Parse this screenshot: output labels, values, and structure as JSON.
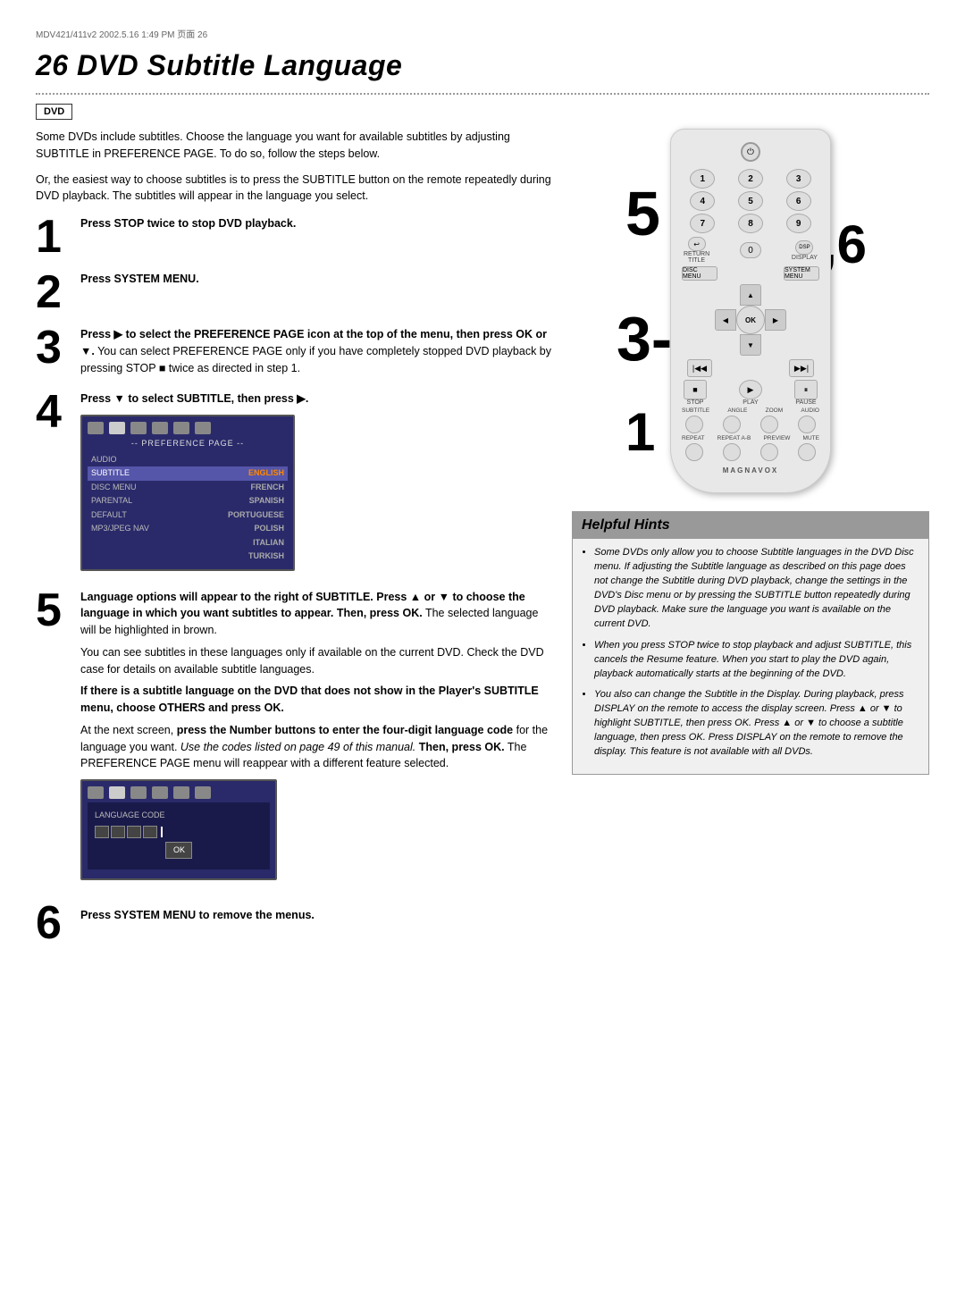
{
  "header": {
    "file_info": "MDV421/411v2  2002.5.16  1:49 PM  页面 26"
  },
  "page": {
    "title": "26  DVD Subtitle Language",
    "dvd_badge": "DVD"
  },
  "intro": {
    "text1": "Some DVDs include subtitles. Choose the language you want for available subtitles by adjusting SUBTITLE in PREFERENCE PAGE. To do so, follow the steps below.",
    "text2": "Or, the easiest way to choose subtitles is to press the SUBTITLE button on the remote repeatedly during DVD playback. The subtitles will appear in the language you select."
  },
  "steps": {
    "step1": {
      "number": "1",
      "text": "Press STOP twice to stop DVD playback."
    },
    "step2": {
      "number": "2",
      "text": "Press SYSTEM MENU."
    },
    "step3": {
      "number": "3",
      "text_bold": "Press ▶ to select the PREFERENCE PAGE icon at the top of the menu, then press OK or ▼.",
      "text_normal": "You can select PREFERENCE PAGE only if you have completely stopped DVD playback by pressing STOP ■ twice as directed in step 1."
    },
    "step4": {
      "number": "4",
      "text": "Press ▼ to select SUBTITLE, then press ▶.",
      "screen": {
        "title": "-- PREFERENCE PAGE --",
        "rows": [
          {
            "label": "AUDIO",
            "value": ""
          },
          {
            "label": "SUBTITLE",
            "value": "ENGLISH",
            "highlighted": true
          },
          {
            "label": "DISC MENU",
            "value": "FRENCH"
          },
          {
            "label": "PARENTAL",
            "value": "SPANISH"
          },
          {
            "label": "DEFAULT",
            "value": "PORTUGUESE"
          },
          {
            "label": "MP3/JPEG NAV",
            "value": "POLISH"
          },
          {
            "label": "",
            "value": "ITALIAN"
          },
          {
            "label": "",
            "value": "TURKISH"
          }
        ]
      }
    },
    "step5": {
      "number": "5",
      "text1_bold": "Language options will appear to the right of SUBTITLE. Press ▲ or ▼ to choose the language in which you want subtitles to appear. Then, press OK.",
      "text1_normal": "The selected language will be highlighted in brown.",
      "text2": "You can see subtitles in these languages only if available on the current DVD. Check the DVD case for details on available subtitle languages.",
      "text3_bold": "If there is a subtitle language on the DVD that does not show in the Player's SUBTITLE menu, choose OTHERS and press OK.",
      "text4": "At the next screen, press the Number buttons to enter the four-digit language code for the language you want.",
      "text4_italic": "Use the codes listed on page 49 of this manual.",
      "text4_end": "Then, press OK. The PREFERENCE PAGE menu will reappear with a different feature selected.",
      "screen2": {
        "lang_code_label": "LANGUAGE CODE",
        "ok_label": "OK"
      }
    },
    "step6": {
      "number": "6",
      "text": "Press SYSTEM MENU to remove the menus."
    }
  },
  "helpful_hints": {
    "title": "Helpful Hints",
    "bullets": [
      "Some DVDs only allow you to choose Subtitle languages in the DVD Disc menu. If adjusting the Subtitle language as described on this page does not change the Subtitle during DVD playback, change the settings in the DVD's Disc menu or by pressing the SUBTITLE button repeatedly during DVD playback. Make sure the language you want is available on the current DVD.",
      "When you press STOP twice to stop playback and adjust SUBTITLE, this cancels the Resume feature. When you start to play the DVD again, playback automatically starts at the beginning of the DVD.",
      "You also can change the Subtitle in the Display. During playback, press DISPLAY on the remote to access the display screen. Press ▲ or ▼ to highlight SUBTITLE, then press OK. Press ▲ or ▼ to choose a subtitle language, then press OK. Press DISPLAY on the remote to remove the display. This feature is not available with all DVDs."
    ]
  },
  "remote": {
    "power_label": "POWER",
    "buttons": {
      "num1": "1",
      "num2": "2",
      "num3": "3",
      "num4": "4",
      "num5": "5",
      "num6": "6",
      "num7": "7",
      "num8": "8",
      "num9": "9",
      "return_label": "RETURN",
      "title_label": "TITLE",
      "display_label": "DISPLAY",
      "zero": "0",
      "disc_label": "DISC",
      "disc_sub": "MENU",
      "system_label": "SYSTEM",
      "system_sub": "MENU",
      "ok_label": "OK",
      "stop_label": "STOP",
      "play_label": "PLAY",
      "pause_label": "PAUSE",
      "subtitle_label": "SUBTITLE",
      "angle_label": "ANGLE",
      "zoom_label": "ZOOM",
      "audio_label": "AUDIO",
      "repeat_label": "REPEAT",
      "repeat_ab_label": "REPEAT",
      "ab_label": "A-B",
      "preview_label": "PREVIEW",
      "mute_label": "MUTE",
      "brand": "MAGNAVOX"
    },
    "step_overlays": {
      "top": "5",
      "right": "2,6",
      "middle": "3-5",
      "bottom": "1"
    }
  }
}
